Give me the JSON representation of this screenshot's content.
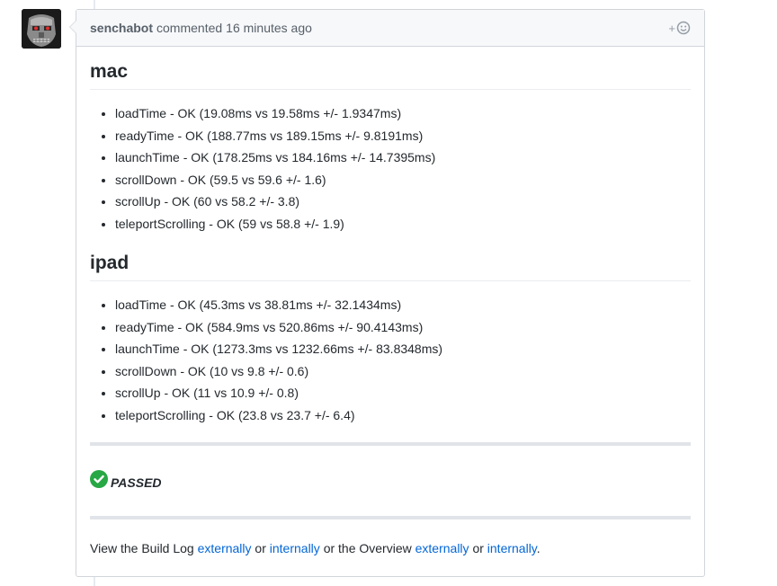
{
  "comment": {
    "author": "senchabot",
    "action": "commented",
    "time": "16 minutes ago",
    "reaction_plus": "+"
  },
  "sections": [
    {
      "title": "mac",
      "items": [
        "loadTime - OK (19.08ms vs 19.58ms +/- 1.9347ms)",
        "readyTime - OK (188.77ms vs 189.15ms +/- 9.8191ms)",
        "launchTime - OK (178.25ms vs 184.16ms +/- 14.7395ms)",
        "scrollDown - OK (59.5 vs 59.6 +/- 1.6)",
        "scrollUp - OK (60 vs 58.2 +/- 3.8)",
        "teleportScrolling - OK (59 vs 58.8 +/- 1.9)"
      ]
    },
    {
      "title": "ipad",
      "items": [
        "loadTime - OK (45.3ms vs 38.81ms +/- 32.1434ms)",
        "readyTime - OK (584.9ms vs 520.86ms +/- 90.4143ms)",
        "launchTime - OK (1273.3ms vs 1232.66ms +/- 83.8348ms)",
        "scrollDown - OK (10 vs 9.8 +/- 0.6)",
        "scrollUp - OK (11 vs 10.9 +/- 0.8)",
        "teleportScrolling - OK (23.8 vs 23.7 +/- 6.4)"
      ]
    }
  ],
  "status": {
    "label": "PASSED",
    "icon": "check-circle-icon",
    "color": "#28a745"
  },
  "footer": {
    "prefix": "View the Build Log",
    "link1": "externally",
    "or1": "or",
    "link2": "internally",
    "middle": "or the Overview",
    "link3": "externally",
    "or2": "or",
    "link4": "internally",
    "end": "."
  }
}
